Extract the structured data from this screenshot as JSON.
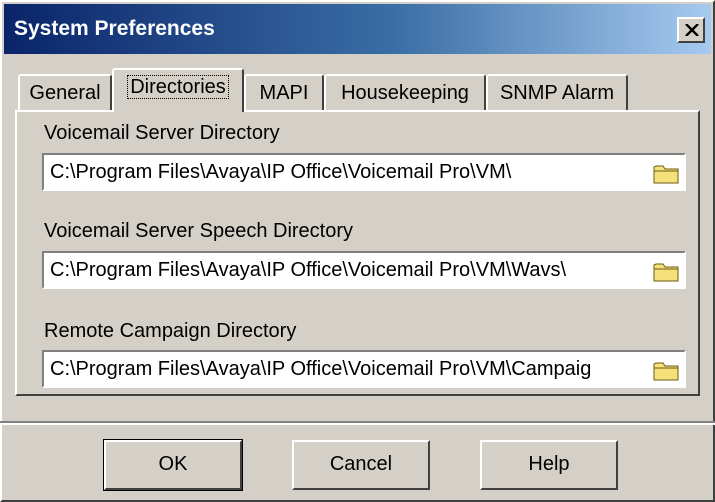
{
  "window": {
    "title": "System Preferences",
    "close_symbol": "X"
  },
  "tabs": [
    {
      "label": "General",
      "active": false
    },
    {
      "label": "Directories",
      "active": true
    },
    {
      "label": "MAPI",
      "active": false
    },
    {
      "label": "Housekeeping",
      "active": false
    },
    {
      "label": "SNMP Alarm",
      "active": false
    }
  ],
  "fields": [
    {
      "label": "Voicemail Server Directory",
      "value": "C:\\Program Files\\Avaya\\IP Office\\Voicemail Pro\\VM\\",
      "icon": "folder-icon"
    },
    {
      "label": "Voicemail Server Speech Directory",
      "value": "C:\\Program Files\\Avaya\\IP Office\\Voicemail Pro\\VM\\Wavs\\",
      "icon": "folder-icon"
    },
    {
      "label": "Remote Campaign Directory",
      "value": "C:\\Program Files\\Avaya\\IP Office\\Voicemail Pro\\VM\\Campaig",
      "icon": "folder-icon"
    }
  ],
  "buttons": {
    "ok": "OK",
    "cancel": "Cancel",
    "help": "Help"
  },
  "colors": {
    "title_start": "#0a246a",
    "title_end": "#a6caf0",
    "face": "#d4d0c8"
  }
}
